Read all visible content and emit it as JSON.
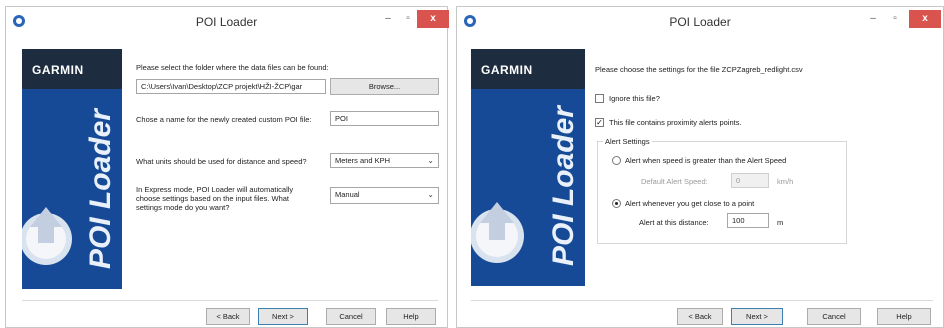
{
  "colors": {
    "sidebar_blue": "#164a96",
    "logo_band": "#1d2d3f",
    "close_red": "#d9534f"
  },
  "window1": {
    "title": "POI Loader",
    "titlebar": {
      "min_icon": "minimize-icon",
      "max_icon": "maximize-icon",
      "close_icon": "close-icon",
      "close_glyph": "x"
    },
    "sidebar": {
      "logo": "GARMIN",
      "vertical_title": "POI Loader"
    },
    "folder_prompt": "Please select the folder where the data files can be found:",
    "folder_path": "C:\\Users\\Ivan\\Desktop\\ZCP projekt\\HŽI-ŽCP\\gar",
    "browse_button": "Browse...",
    "name_prompt": "Chose a name for the newly created custom POI file:",
    "name_value": "POI",
    "units_prompt": "What units should be used for distance and speed?",
    "units_value": "Meters and KPH",
    "mode_prompt": "In Express mode, POI Loader will automatically choose settings based on the input files. What settings mode do you want?",
    "mode_value": "Manual",
    "buttons": {
      "back": "< Back",
      "next": "Next >",
      "cancel": "Cancel",
      "help": "Help"
    }
  },
  "window2": {
    "title": "POI Loader",
    "titlebar": {
      "min_icon": "minimize-icon",
      "max_icon": "maximize-icon",
      "close_icon": "close-icon",
      "close_glyph": "x"
    },
    "sidebar": {
      "logo": "GARMIN",
      "vertical_title": "POI Loader"
    },
    "settings_prompt": "Please choose the settings for the file ZCPZagreb_redlight.csv",
    "ignore_label": "Ignore this file?",
    "ignore_checked": false,
    "proximity_label": "This file contains proximity alerts points.",
    "proximity_checked": true,
    "alert_group_title": "Alert Settings",
    "radio_speed_label": "Alert when speed is greater than the Alert Speed",
    "default_speed_label": "Default Alert Speed:",
    "default_speed_value": "0",
    "speed_unit": "km/h",
    "radio_distance_label": "Alert whenever you get close to a point",
    "distance_label": "Alert at this distance:",
    "distance_value": "100",
    "distance_unit": "m",
    "buttons": {
      "back": "< Back",
      "next": "Next >",
      "cancel": "Cancel",
      "help": "Help"
    }
  }
}
